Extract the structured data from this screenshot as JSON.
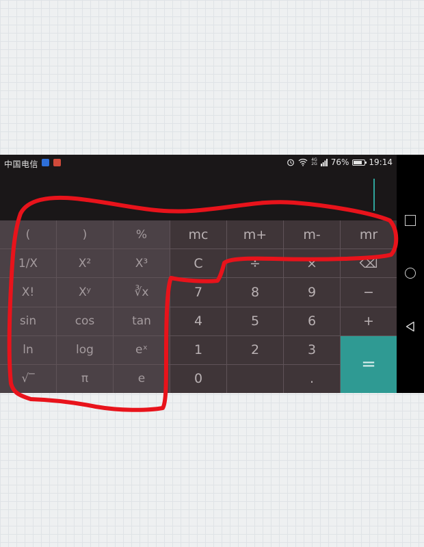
{
  "statusbar": {
    "carrier": "中国电信",
    "net_type_top": "4G",
    "net_type_bottom": "2G",
    "battery": "76%",
    "battery_level": 0.76,
    "time": "19:14",
    "icons": [
      "shield-icon",
      "app-notification-icon",
      "alarm-icon",
      "wifi-icon",
      "signal-icon",
      "battery-icon"
    ]
  },
  "keys": [
    [
      "(",
      ")",
      "%",
      "mc",
      "m+",
      "m-",
      "mr"
    ],
    [
      "1/X",
      "X²",
      "X³",
      "C",
      "÷",
      "×",
      "⌫"
    ],
    [
      "X!",
      "Xʸ",
      "∛x",
      "7",
      "8",
      "9",
      "−"
    ],
    [
      "sin",
      "cos",
      "tan",
      "4",
      "5",
      "6",
      "+"
    ],
    [
      "ln",
      "log",
      "eˣ",
      "1",
      "2",
      "3",
      "="
    ],
    [
      "√‾",
      "π",
      "e",
      "0",
      "",
      ".",
      ""
    ]
  ],
  "navbar": {
    "icons": [
      "recents-square-icon",
      "home-circle-icon",
      "back-triangle-icon"
    ]
  },
  "colors": {
    "keypad_bg": "#3f3538",
    "scientific_key_bg": "#4b4146",
    "equals_bg": "#2f9a93",
    "cursor": "#2fa59c",
    "annotation_red": "#e8131b"
  }
}
